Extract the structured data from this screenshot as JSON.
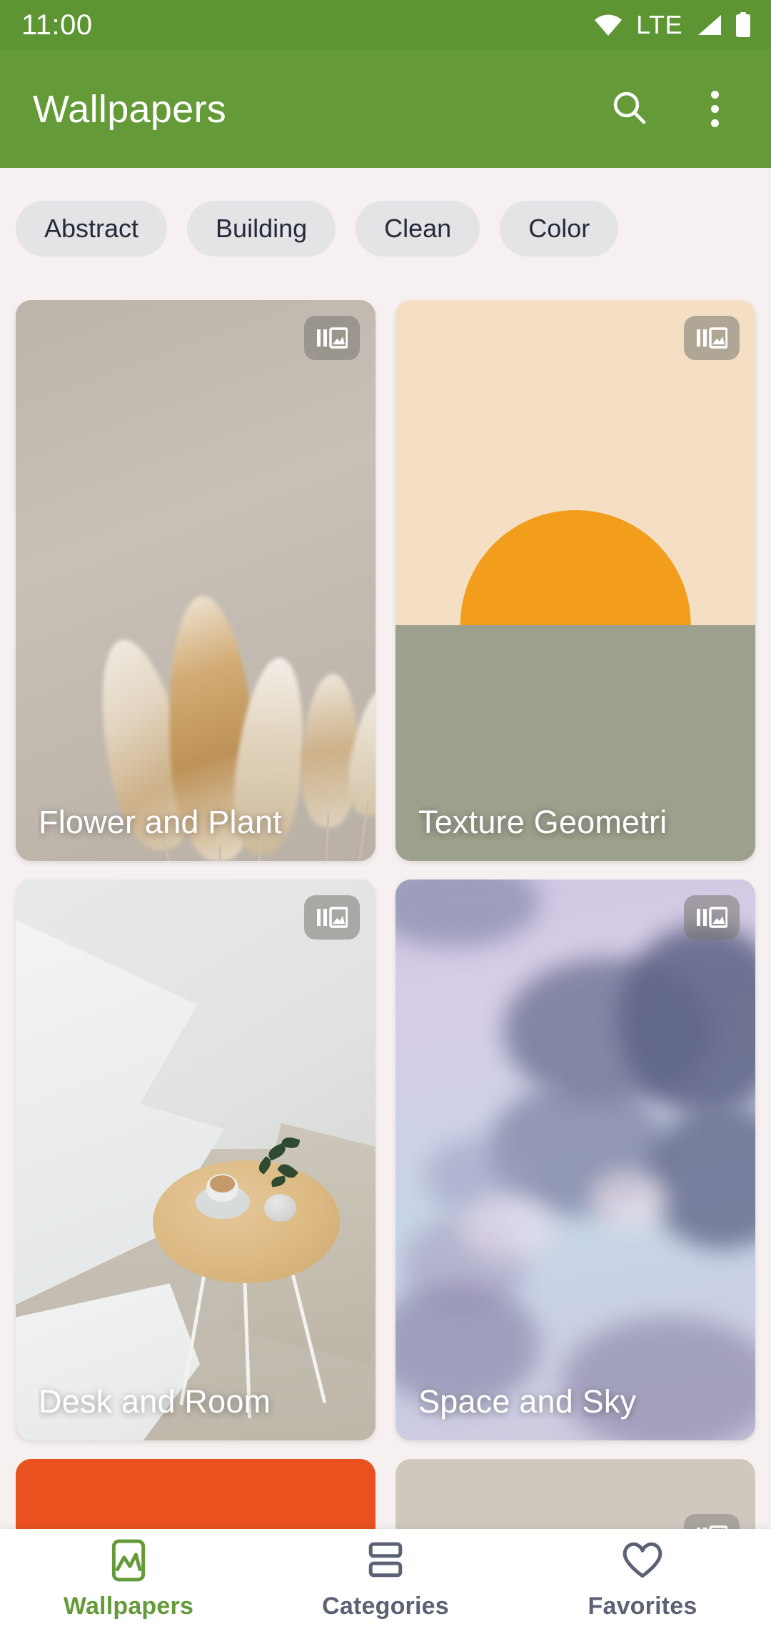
{
  "status_bar": {
    "time": "11:00",
    "network_label": "LTE",
    "icons": [
      "wifi-icon",
      "signal-icon",
      "battery-icon"
    ],
    "background": "#5E9533"
  },
  "app_bar": {
    "title": "Wallpapers",
    "background": "#649B38",
    "actions": [
      {
        "name": "search-icon",
        "label": "Search"
      },
      {
        "name": "overflow-menu-icon",
        "label": "More options"
      }
    ]
  },
  "categories": {
    "chips": [
      {
        "label": "Abstract"
      },
      {
        "label": "Building"
      },
      {
        "label": "Clean"
      },
      {
        "label": "Color"
      }
    ],
    "chip_background": "#E4E4E6",
    "chip_text_color": "#262B3A"
  },
  "wallpaper_grid": {
    "badge_icon": "collection-photo-icon",
    "items": [
      {
        "title": "Flower and Plant",
        "art": "pampas-grass-beige",
        "colors": {
          "background": "#BDB5AB",
          "accent": "#C9A87C"
        }
      },
      {
        "title": "Texture Geometri",
        "art": "sun-horizon-geometric",
        "colors": {
          "sky": "#F4DFC4",
          "sun": "#F29D1C",
          "ground": "#9CA08C"
        }
      },
      {
        "title": "Desk and Room",
        "art": "white-interior-wood-table",
        "colors": {
          "background": "#E5E8E8",
          "wood": "#DCB982",
          "floor": "#C4BEB2"
        }
      },
      {
        "title": "Space and Sky",
        "art": "pastel-cloud-sky",
        "colors": {
          "background": "#CFC6E2",
          "highlight": "#EAD8EE",
          "shadow": "#6E7390"
        }
      }
    ],
    "partial_items": [
      {
        "title": "",
        "art": "solid-orange",
        "colors": {
          "background": "#E9511E"
        }
      },
      {
        "title": "",
        "art": "grey-teal-geometric",
        "colors": {
          "background": "#C7CACB",
          "accent": "#16B394"
        }
      }
    ]
  },
  "bottom_nav": {
    "active_color": "#649B38",
    "inactive_color": "#5C6274",
    "items": [
      {
        "label": "Wallpapers",
        "icon": "image-frame-icon",
        "active": true
      },
      {
        "label": "Categories",
        "icon": "stacked-rows-icon",
        "active": false
      },
      {
        "label": "Favorites",
        "icon": "heart-icon",
        "active": false
      }
    ]
  },
  "page_background": "#F6F1F0"
}
